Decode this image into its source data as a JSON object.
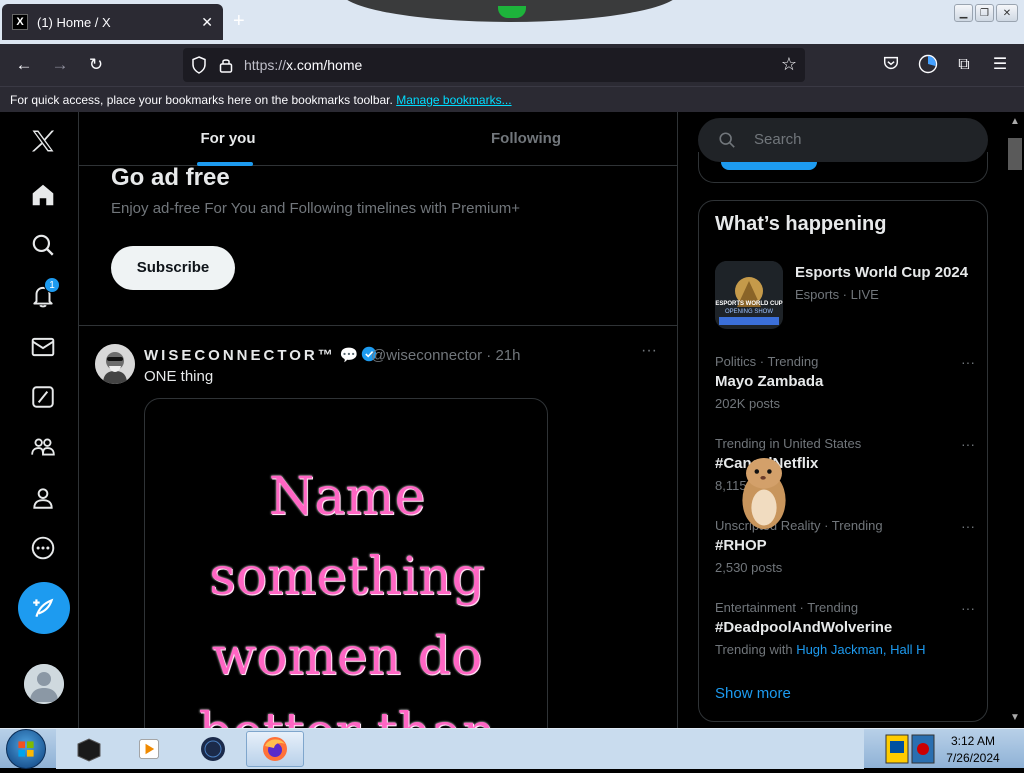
{
  "browser": {
    "tab_title": "(1) Home / X",
    "tab_favicon": "X",
    "new_tab": "+",
    "url_scheme": "https://",
    "url_host": "x.com/home",
    "bookmarks_hint": "For quick access, place your bookmarks here on the bookmarks toolbar.",
    "bookmarks_link": "Manage bookmarks..."
  },
  "nav": {
    "notification_count": "1"
  },
  "feed": {
    "tab_for_you": "For you",
    "tab_following": "Following"
  },
  "premium": {
    "title": "Go ad free",
    "subtitle": "Enjoy ad-free For You and Following timelines with Premium+",
    "button": "Subscribe"
  },
  "post": {
    "name": "WISECONNECTOR™",
    "handle": "@wiseconnector · 21h",
    "text": "ONE thing",
    "more": "···",
    "media_lines": [
      "Name",
      "something",
      "women do",
      "better than"
    ]
  },
  "sidebar": {
    "search_placeholder": "Search",
    "happening_title": "What’s happening",
    "event": {
      "title": "Esports World Cup 2024",
      "meta": "Esports · LIVE",
      "thumb_text_top": "ESPORTS WORLD CUP",
      "thumb_text_bottom": "OPENING SHOW"
    },
    "trends": [
      {
        "category": "Politics · Trending",
        "name": "Mayo Zambada",
        "posts": "202K posts"
      },
      {
        "category": "Trending in United States",
        "name": "#CancelNetflix",
        "posts": "8,115 posts"
      },
      {
        "category": "Unscripted Reality · Trending",
        "name": "#RHOP",
        "posts": "2,530 posts"
      },
      {
        "category": "Entertainment · Trending",
        "name": "#DeadpoolAndWolverine",
        "posts_prefix": "Trending with",
        "posts_link": "Hugh Jackman, Hall H"
      }
    ],
    "trend_more": "···",
    "show_more": "Show more"
  },
  "taskbar": {
    "time": "3:12 AM",
    "date": "7/26/2024"
  }
}
